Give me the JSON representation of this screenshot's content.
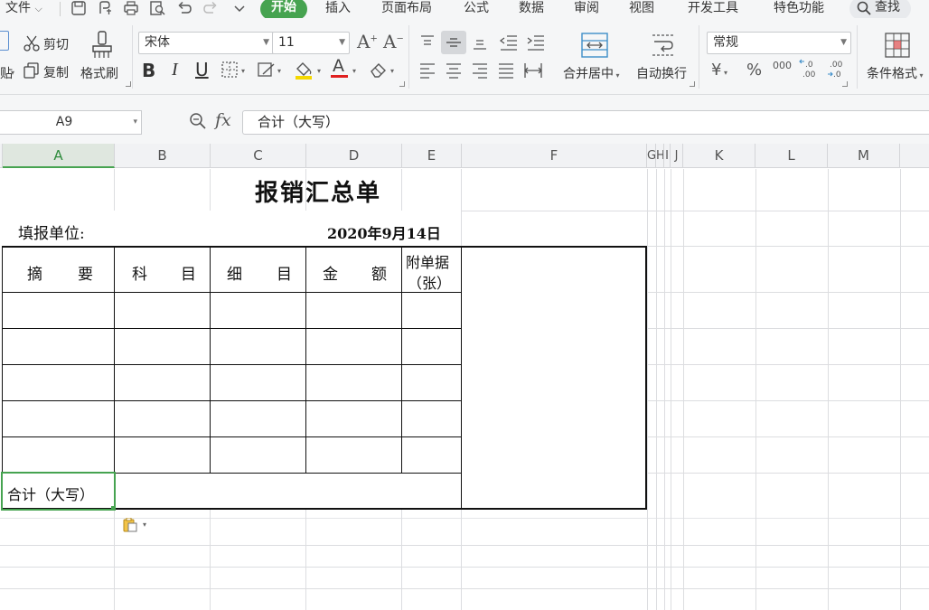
{
  "menubar": {
    "file": "文件",
    "tabs": [
      "开始",
      "插入",
      "页面布局",
      "公式",
      "数据",
      "审阅",
      "视图",
      "开发工具",
      "特色功能"
    ],
    "search": "查找"
  },
  "ribbon": {
    "paste_partial": "贴",
    "cut": "剪切",
    "copy": "复制",
    "format_painter": "格式刷",
    "font_name": "宋体",
    "font_size": "11",
    "bold": "B",
    "italic": "I",
    "underline": "U",
    "merge_center": "合并居中",
    "wrap_text": "自动换行",
    "number_format": "常规",
    "currency": "¥",
    "percent": "%",
    "thousands": "000",
    "conditional_format": "条件格式"
  },
  "formula_bar": {
    "name_box": "A9",
    "fx": "fx",
    "content": "合计（大写）"
  },
  "columns": [
    "A",
    "B",
    "C",
    "D",
    "E",
    "F",
    "G",
    "H",
    "I",
    "J",
    "K",
    "L",
    "M"
  ],
  "selected_column": "A",
  "sheet": {
    "title": "报销汇总单",
    "unit_label": "填报单位:",
    "date": "2020年9月14日",
    "headers": {
      "summary": [
        "摘",
        "要"
      ],
      "subject": [
        "科",
        "目"
      ],
      "detail": [
        "细",
        "目"
      ],
      "amount": [
        "金",
        "额"
      ],
      "attachments_line1": "附单据",
      "attachments_line2": "（张）"
    },
    "total_label": "合计（大写）"
  },
  "colors": {
    "accent": "#46a350",
    "ribbon_bg": "#f5f6f7"
  }
}
